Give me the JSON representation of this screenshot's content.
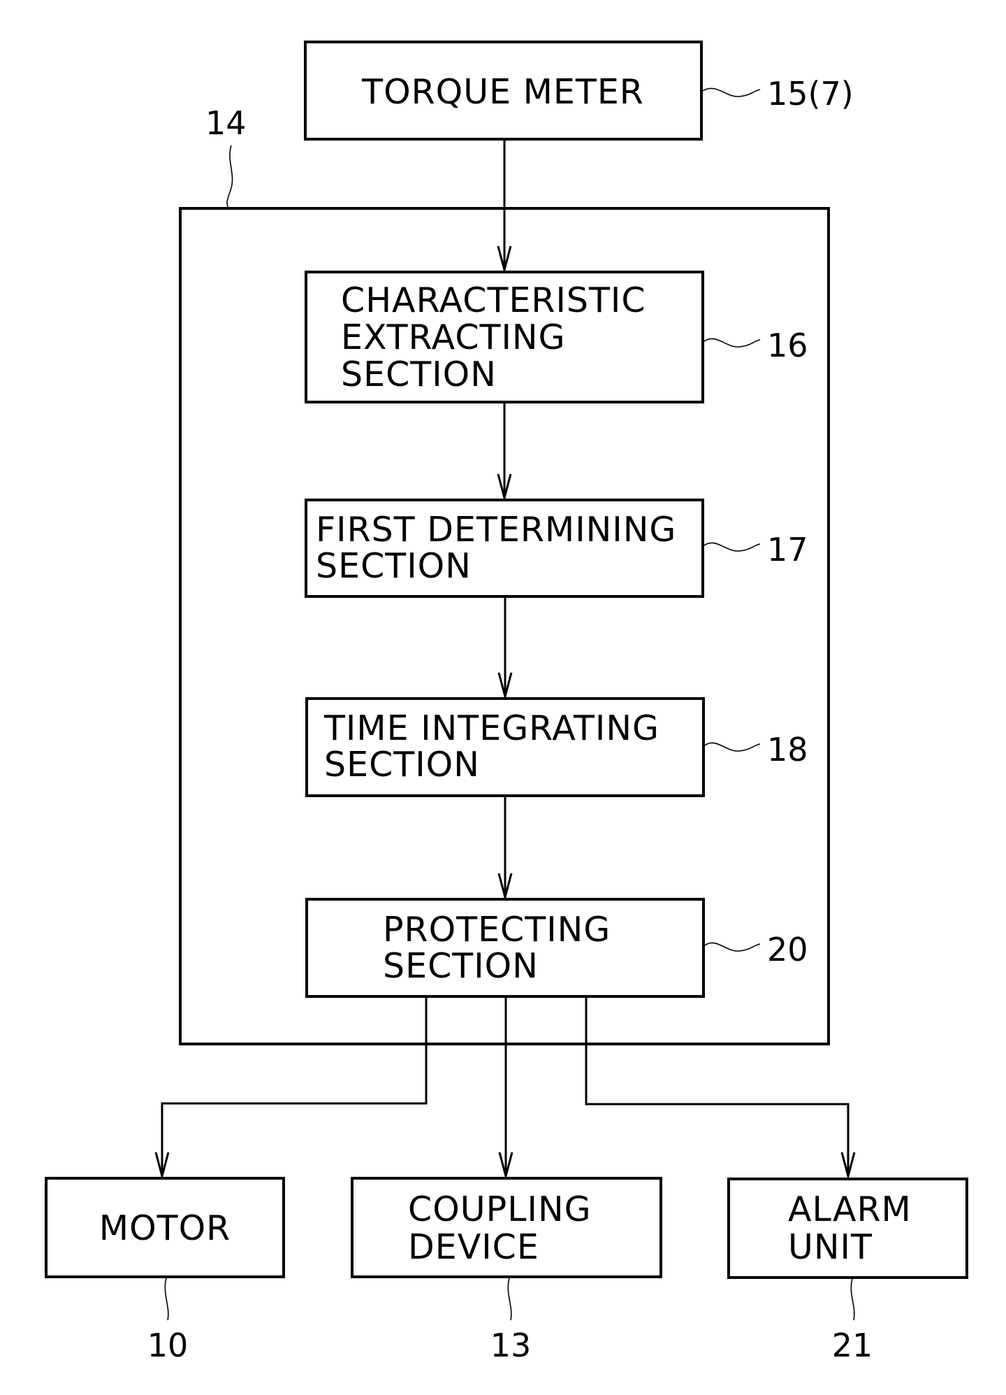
{
  "diagram": {
    "type": "block-diagram",
    "colors": {
      "stroke": "#000000",
      "background": "#ffffff"
    },
    "container": {
      "ref": "14"
    },
    "blocks": {
      "torque_meter": {
        "lines": [
          "TORQUE METER"
        ],
        "ref": "15(7)"
      },
      "characteristic": {
        "lines": [
          "CHARACTERISTIC",
          "EXTRACTING",
          "SECTION"
        ],
        "ref": "16"
      },
      "first_determining": {
        "lines": [
          "FIRST DETERMINING",
          "SECTION"
        ],
        "ref": "17"
      },
      "time_integrating": {
        "lines": [
          "TIME INTEGRATING",
          "SECTION"
        ],
        "ref": "18"
      },
      "protecting": {
        "lines": [
          "PROTECTING",
          "SECTION"
        ],
        "ref": "20"
      },
      "motor": {
        "lines": [
          "MOTOR"
        ],
        "ref": "10"
      },
      "coupling": {
        "lines": [
          "COUPLING",
          "DEVICE"
        ],
        "ref": "13"
      },
      "alarm": {
        "lines": [
          "ALARM",
          "UNIT"
        ],
        "ref": "21"
      }
    },
    "edges": [
      {
        "from": "torque_meter",
        "to": "characteristic"
      },
      {
        "from": "characteristic",
        "to": "first_determining"
      },
      {
        "from": "first_determining",
        "to": "time_integrating"
      },
      {
        "from": "time_integrating",
        "to": "protecting"
      },
      {
        "from": "protecting",
        "to": "motor"
      },
      {
        "from": "protecting",
        "to": "coupling"
      },
      {
        "from": "protecting",
        "to": "alarm"
      }
    ]
  }
}
